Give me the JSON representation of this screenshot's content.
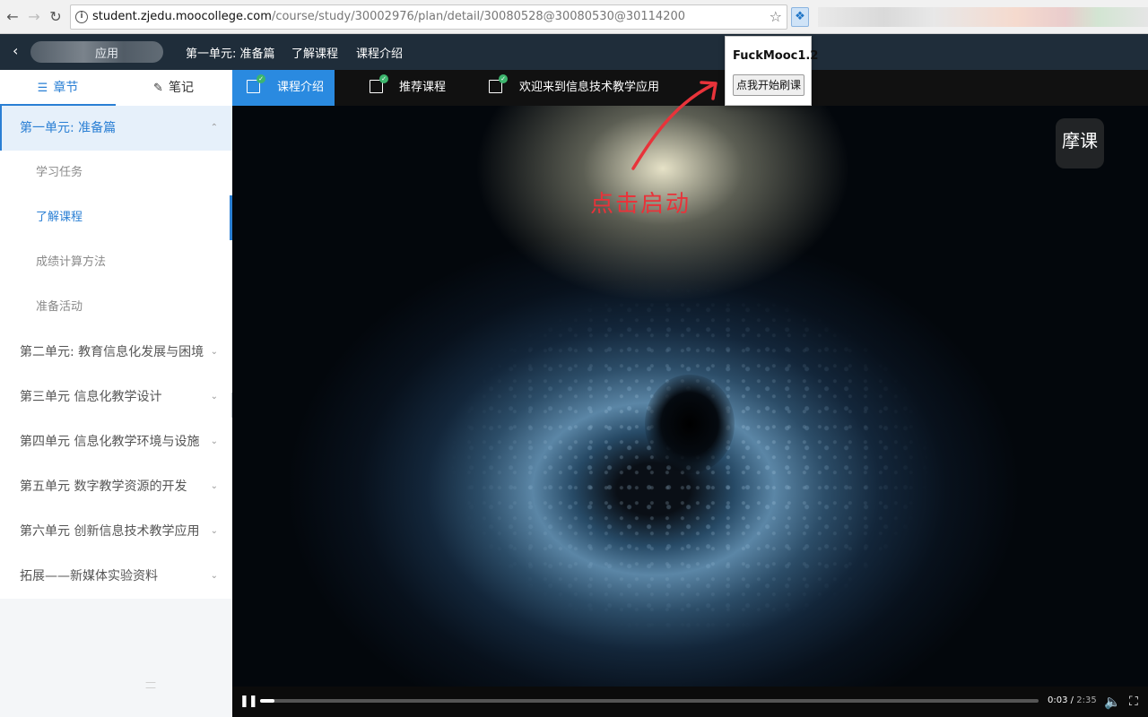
{
  "browser": {
    "url_host": "student.zjedu.moocollege.com",
    "url_path": "/course/study/30002976/plan/detail/30080528@30080530@30114200"
  },
  "header": {
    "course_suffix": "应用",
    "crumbs": [
      "第一单元: 准备篇",
      "了解课程",
      "课程介绍"
    ]
  },
  "sidebar": {
    "tabs": [
      {
        "label": "章节",
        "icon": "list-icon"
      },
      {
        "label": "笔记",
        "icon": "pencil-icon"
      }
    ],
    "items": [
      {
        "label": "第一单元: 准备篇",
        "type": "unit",
        "expanded": true
      },
      {
        "label": "学习任务",
        "type": "sub"
      },
      {
        "label": "了解课程",
        "type": "sub",
        "current": true
      },
      {
        "label": "成绩计算方法",
        "type": "sub"
      },
      {
        "label": "准备活动",
        "type": "sub"
      },
      {
        "label": "第二单元: 教育信息化发展与困境",
        "type": "unit"
      },
      {
        "label": "第三单元 信息化教学设计",
        "type": "unit"
      },
      {
        "label": "第四单元 信息化教学环境与设施",
        "type": "unit"
      },
      {
        "label": "第五单元 数字教学资源的开发",
        "type": "unit"
      },
      {
        "label": "第六单元 创新信息技术教学应用",
        "type": "unit"
      },
      {
        "label": "拓展——新媒体实验资料",
        "type": "unit"
      }
    ]
  },
  "lesson_tabs": [
    {
      "label": "课程介绍",
      "active": true
    },
    {
      "label": "推荐课程"
    },
    {
      "label": "欢迎来到信息技术教学应用"
    }
  ],
  "video": {
    "watermark": "摩课",
    "annotation": "点击启动",
    "current_time": "0:03",
    "separator": "/",
    "duration": "2:35",
    "progress_fraction": 0.019
  },
  "extension_popup": {
    "title": "FuckMooc1.2",
    "button": "点我开始刷课"
  },
  "colors": {
    "accent": "#2a7fd4",
    "header_bg": "#1f2d3a",
    "annotation": "#e8333a"
  }
}
